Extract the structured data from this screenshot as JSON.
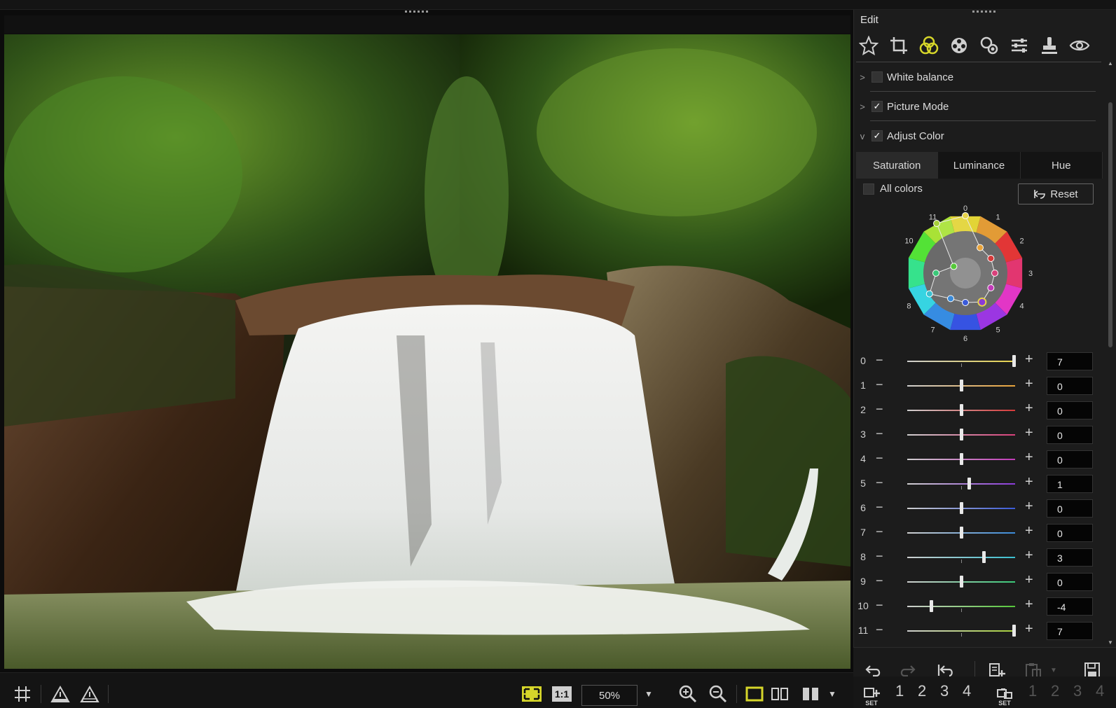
{
  "panel": {
    "title": "Edit",
    "tools": [
      "star-icon",
      "crop-icon",
      "color-circles-icon",
      "film-reel-icon",
      "retouch-icon",
      "sliders-icon",
      "stamp-icon",
      "eye-icon"
    ],
    "sections": [
      {
        "label": "White balance",
        "expanded": false,
        "checked": false
      },
      {
        "label": "Picture Mode",
        "expanded": false,
        "checked": true
      },
      {
        "label": "Adjust Color",
        "expanded": true,
        "checked": true
      }
    ],
    "tabs": [
      "Saturation",
      "Luminance",
      "Hue"
    ],
    "active_tab": "Saturation",
    "all_colors_label": "All colors",
    "reset_label": "Reset",
    "wheel_labels": [
      "0",
      "1",
      "2",
      "3",
      "4",
      "5",
      "6",
      "7",
      "8",
      "9",
      "10",
      "11"
    ],
    "sliders": [
      {
        "index": "0",
        "value": "7",
        "color": "#e6d24a"
      },
      {
        "index": "1",
        "value": "0",
        "color": "#e8a33a"
      },
      {
        "index": "2",
        "value": "0",
        "color": "#d63a3a"
      },
      {
        "index": "3",
        "value": "0",
        "color": "#d8407a"
      },
      {
        "index": "4",
        "value": "0",
        "color": "#c23ab8"
      },
      {
        "index": "5",
        "value": "1",
        "color": "#8a3ad8"
      },
      {
        "index": "6",
        "value": "0",
        "color": "#3a5ad8"
      },
      {
        "index": "7",
        "value": "0",
        "color": "#3a8ad8"
      },
      {
        "index": "8",
        "value": "3",
        "color": "#3ac0d0"
      },
      {
        "index": "9",
        "value": "0",
        "color": "#3ac878"
      },
      {
        "index": "10",
        "value": "-4",
        "color": "#56c83a"
      },
      {
        "index": "11",
        "value": "7",
        "color": "#a6cf3a"
      }
    ],
    "slider_range": [
      -7,
      7
    ],
    "set_numbers": [
      "1",
      "2",
      "3",
      "4"
    ],
    "set_numbers_2": [
      "1",
      "2",
      "3",
      "4"
    ]
  },
  "viewer": {
    "zoom": "50%"
  }
}
